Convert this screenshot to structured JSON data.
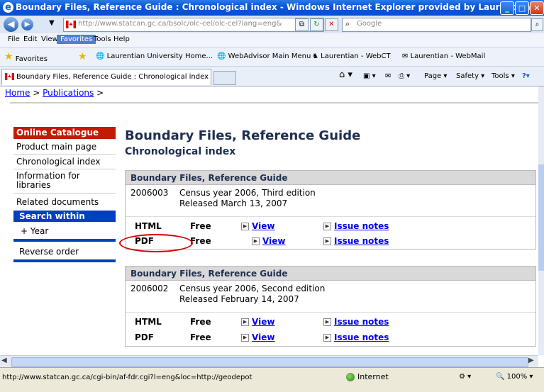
{
  "window": {
    "title": "Boundary Files, Reference Guide : Chronological index - Windows Internet Explorer provided by Laurentian U..."
  },
  "address": {
    "url": "http://www.statcan.gc.ca/bsolc/olc-cel/olc-cel?lang=eng&",
    "search_placeholder": "Google"
  },
  "menu": [
    "File",
    "Edit",
    "View",
    "Favorites",
    "Tools",
    "Help"
  ],
  "favorites": {
    "label": "Favorites",
    "links": [
      "Laurentian University Home...",
      "WebAdvisor Main Menu",
      "Laurentian - WebCT",
      "Laurentian - WebMail"
    ]
  },
  "tab": {
    "title": "Boundary Files, Reference Guide : Chronological index"
  },
  "toolbar": {
    "page": "Page",
    "safety": "Safety",
    "tools": "Tools"
  },
  "breadcrumb": {
    "home": "Home",
    "sep": ">",
    "publications": "Publications"
  },
  "sidebar": {
    "heading": "Online Catalogue",
    "items": [
      "Product main page",
      "Chronological index",
      "Information for libraries",
      "Related documents"
    ],
    "search_within": "Search within",
    "year": "+ Year",
    "reverse": "Reverse order"
  },
  "main": {
    "title": "Boundary Files, Reference Guide",
    "subtitle": "Chronological index",
    "editions": [
      {
        "header": "Boundary Files, Reference Guide",
        "code": "2006003",
        "line1": "Census year 2006, Third edition",
        "line2": "Released March 13, 2007",
        "rows": [
          {
            "format": "HTML",
            "price": "Free",
            "view": "View",
            "notes": "Issue notes"
          },
          {
            "format": "PDF",
            "price": "Free",
            "view": "View",
            "notes": "Issue notes"
          }
        ]
      },
      {
        "header": "Boundary Files, Reference Guide",
        "code": "2006002",
        "line1": "Census year 2006, Second edition",
        "line2": "Released February 14, 2007",
        "rows": [
          {
            "format": "HTML",
            "price": "Free",
            "view": "View",
            "notes": "Issue notes"
          },
          {
            "format": "PDF",
            "price": "Free",
            "view": "View",
            "notes": "Issue notes"
          }
        ]
      }
    ]
  },
  "status": {
    "url": "http://www.statcan.gc.ca/cgi-bin/af-fdr.cgi?l=eng&loc=http://geodepot",
    "zone": "Internet",
    "zoom": "100%"
  }
}
